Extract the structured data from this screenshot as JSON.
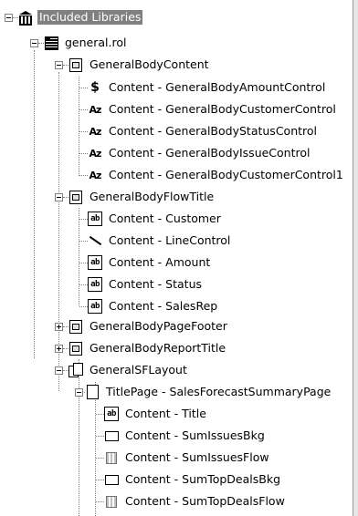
{
  "tree": {
    "root": {
      "label": "Included Libraries",
      "icon": "library-icon"
    },
    "library": {
      "label": "general.rol",
      "icon": "report-icon"
    },
    "body_content": {
      "label": "GeneralBodyContent",
      "children": [
        {
          "label": "Content - GeneralBodyAmountControl",
          "icon": "dollar-icon"
        },
        {
          "label": "Content - GeneralBodyCustomerControl",
          "icon": "az-icon"
        },
        {
          "label": "Content - GeneralBodyStatusControl",
          "icon": "az-icon"
        },
        {
          "label": "Content - GeneralBodyIssueControl",
          "icon": "az-icon"
        },
        {
          "label": "Content - GeneralBodyCustomerControl1",
          "icon": "az-icon"
        }
      ]
    },
    "flow_title": {
      "label": "GeneralBodyFlowTitle",
      "children": [
        {
          "label": "Content - Customer",
          "icon": "ab-icon"
        },
        {
          "label": "Content - LineControl",
          "icon": "line-icon"
        },
        {
          "label": "Content - Amount",
          "icon": "ab-icon"
        },
        {
          "label": "Content - Status",
          "icon": "ab-icon"
        },
        {
          "label": "Content - SalesRep",
          "icon": "ab-icon"
        }
      ]
    },
    "page_footer": {
      "label": "GeneralBodyPageFooter"
    },
    "report_title": {
      "label": "GeneralBodyReportTitle"
    },
    "sf_layout": {
      "label": "GeneralSFLayout"
    },
    "title_page": {
      "label": "TitlePage - SalesForecastSummaryPage",
      "children": [
        {
          "label": "Content - Title",
          "icon": "ab-icon"
        },
        {
          "label": "Content - SumIssuesBkg",
          "icon": "rect-icon"
        },
        {
          "label": "Content - SumIssuesFlow",
          "icon": "flow-icon"
        },
        {
          "label": "Content - SumTopDealsBkg",
          "icon": "rect-icon"
        },
        {
          "label": "Content - SumTopDealsFlow",
          "icon": "flow-icon"
        }
      ]
    }
  }
}
